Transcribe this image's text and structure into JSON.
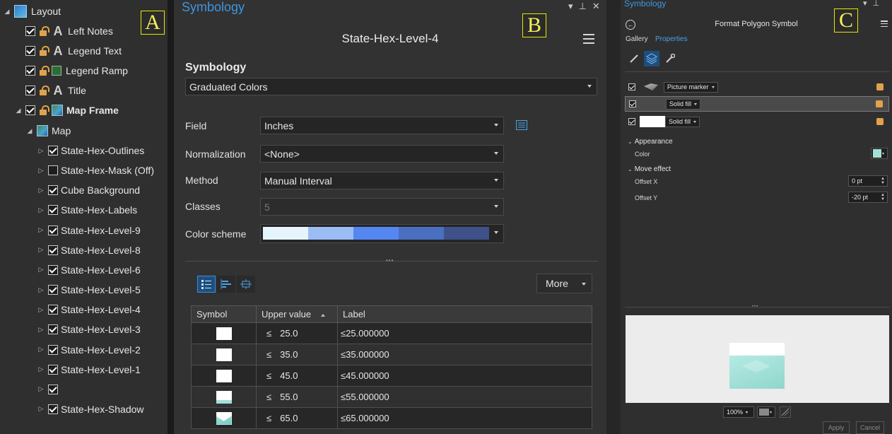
{
  "panelA": {
    "badge": "A",
    "root": {
      "label": "Layout",
      "icon": "layout-icon"
    },
    "layout_items": [
      {
        "label": "Left Notes",
        "icon": "text-icon",
        "checked": true
      },
      {
        "label": "Legend Text",
        "icon": "text-icon",
        "checked": true
      },
      {
        "label": "Legend Ramp",
        "icon": "ramp-icon",
        "checked": true
      },
      {
        "label": "Title",
        "icon": "text-icon",
        "checked": true
      }
    ],
    "map_frame": {
      "label": "Map Frame",
      "checked": true
    },
    "map": {
      "label": "Map"
    },
    "layers": [
      {
        "label": "State-Hex-Outlines",
        "checked": true
      },
      {
        "label": "State-Hex-Mask (Off)",
        "checked": false
      },
      {
        "label": "Cube Background",
        "checked": true
      },
      {
        "label": "State-Hex-Labels",
        "checked": true
      },
      {
        "label": "State-Hex-Level-9",
        "checked": true
      },
      {
        "label": "State-Hex-Level-8",
        "checked": true
      },
      {
        "label": "State-Hex-Level-6",
        "checked": true
      },
      {
        "label": "State-Hex-Level-5",
        "checked": true
      },
      {
        "label": "State-Hex-Level-4",
        "checked": true
      },
      {
        "label": "State-Hex-Level-3",
        "checked": true
      },
      {
        "label": "State-Hex-Level-2",
        "checked": true
      },
      {
        "label": "State-Hex-Level-1",
        "checked": true
      },
      {
        "label": "",
        "checked": true
      },
      {
        "label": "State-Hex-Shadow",
        "checked": true
      }
    ]
  },
  "panelB": {
    "badge": "B",
    "pane_title": "Symbology",
    "layer_name": "State-Hex-Level-4",
    "section_heading": "Symbology",
    "renderer": "Graduated Colors",
    "field_label": "Field",
    "field_value": "Inches",
    "normalization_label": "Normalization",
    "normalization_value": "<None>",
    "method_label": "Method",
    "method_value": "Manual Interval",
    "classes_label": "Classes",
    "classes_value": "5",
    "color_scheme_label": "Color scheme",
    "color_scheme_colors": [
      "#e6f5fb",
      "#9cbcf5",
      "#5587f0",
      "#4a6fc0",
      "#3e5189"
    ],
    "more_label": "More",
    "table": {
      "headers": {
        "symbol": "Symbol",
        "upper": "Upper value",
        "label": "Label"
      },
      "rows": [
        {
          "op": "≤",
          "upper": "25.0",
          "label": "≤25.000000",
          "symbol": "plain"
        },
        {
          "op": "≤",
          "upper": "35.0",
          "label": "≤35.000000",
          "symbol": "plain"
        },
        {
          "op": "≤",
          "upper": "45.0",
          "label": "≤45.000000",
          "symbol": "plain"
        },
        {
          "op": "≤",
          "upper": "55.0",
          "label": "≤55.000000",
          "symbol": "p4"
        },
        {
          "op": "≤",
          "upper": "65.0",
          "label": "≤65.000000",
          "symbol": "p5"
        }
      ]
    }
  },
  "panelC": {
    "badge": "C",
    "pane_title": "Symbology",
    "header": "Format Polygon Symbol",
    "tab_gallery": "Gallery",
    "tab_properties": "Properties",
    "layers": [
      {
        "label": "Picture marker",
        "checked": true
      },
      {
        "label": "Solid fill",
        "checked": true
      },
      {
        "label": "Solid fill",
        "checked": true
      }
    ],
    "appearance_heading": "Appearance",
    "color_label": "Color",
    "color_value": "#a3e0d8",
    "move_heading": "Move effect",
    "offset_x_label": "Offset X",
    "offset_x_value": "0 pt",
    "offset_y_label": "Offset Y",
    "offset_y_value": "-20 pt",
    "zoom_value": "100%",
    "apply_label": "Apply",
    "cancel_label": "Cancel"
  }
}
